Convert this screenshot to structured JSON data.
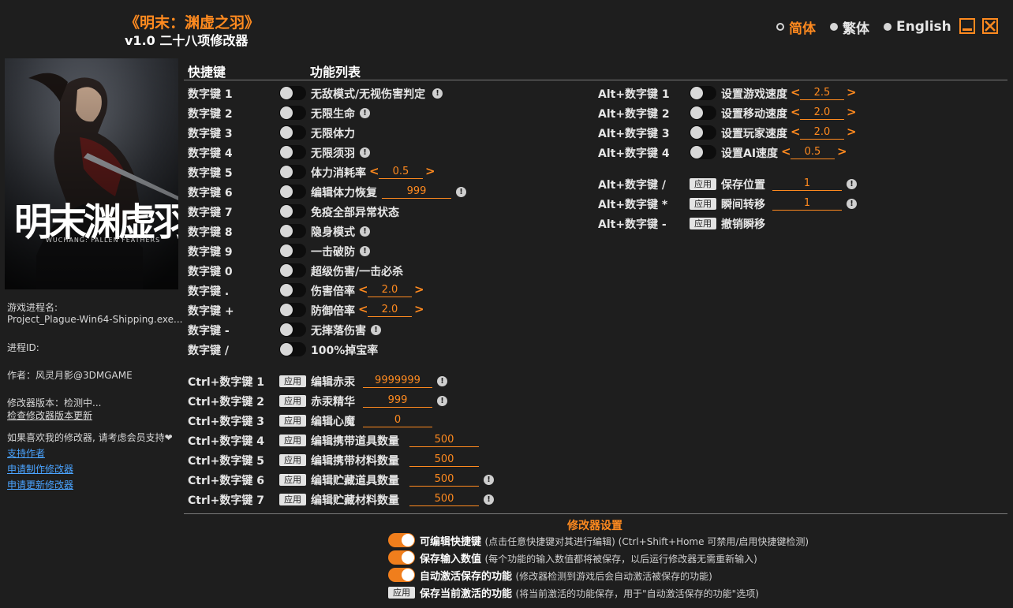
{
  "header": {
    "title": "《明末：渊虚之羽》",
    "subtitle": "v1.0 二十八项修改器",
    "languages": [
      "简体",
      "繁体",
      "English"
    ],
    "active_language": "简体"
  },
  "cover": {
    "title_art": "明末渊虚羽",
    "tagline": "WUCHANG: FALLEN FEATHERS"
  },
  "sidebar": {
    "process_label": "游戏进程名:",
    "process_name": "Project_Plague-Win64-Shipping.exe...",
    "pid_label": "进程ID:",
    "author": "作者：风灵月影@3DMGAME",
    "version": "修改器版本：检测中...",
    "check_update": "检查修改器版本更新",
    "support_text": "如果喜欢我的修改器, 请考虑会员支持❤",
    "links": [
      "支持作者",
      "申请制作修改器",
      "申请更新修改器"
    ]
  },
  "columns": {
    "hotkey": "快捷键",
    "features": "功能列表"
  },
  "apply_label": "应用",
  "left_toggles": [
    {
      "key": "数字键 1",
      "label": "无敌模式/无视伤害判定",
      "info": true
    },
    {
      "key": "数字键 2",
      "label": "无限生命",
      "info": true
    },
    {
      "key": "数字键 3",
      "label": "无限体力"
    },
    {
      "key": "数字键 4",
      "label": "无限须羽",
      "info": true
    },
    {
      "key": "数字键 5",
      "label": "体力消耗率",
      "stepper": "0.5"
    },
    {
      "key": "数字键 6",
      "label": "编辑体力恢复",
      "input": "999",
      "info": true
    },
    {
      "key": "数字键 7",
      "label": "免疫全部异常状态"
    },
    {
      "key": "数字键 8",
      "label": "隐身模式",
      "info": true
    },
    {
      "key": "数字键 9",
      "label": "一击破防",
      "info": true
    },
    {
      "key": "数字键 0",
      "label": "超级伤害/一击必杀"
    },
    {
      "key": "数字键 .",
      "label": "伤害倍率",
      "stepper": "2.0"
    },
    {
      "key": "数字键 +",
      "label": "防御倍率",
      "stepper": "2.0"
    },
    {
      "key": "数字键 -",
      "label": "无摔落伤害",
      "info": true
    },
    {
      "key": "数字键 /",
      "label": "100%掉宝率"
    }
  ],
  "ctrl_items": [
    {
      "key": "Ctrl+数字键 1",
      "label": "编辑赤汞",
      "input": "9999999",
      "info": true
    },
    {
      "key": "Ctrl+数字键 2",
      "label": "赤汞精华",
      "input": "999",
      "info": true
    },
    {
      "key": "Ctrl+数字键 3",
      "label": "编辑心魔",
      "input": "0"
    },
    {
      "key": "Ctrl+数字键 4",
      "label": "编辑携带道具数量",
      "input": "500"
    },
    {
      "key": "Ctrl+数字键 5",
      "label": "编辑携带材料数量",
      "input": "500"
    },
    {
      "key": "Ctrl+数字键 6",
      "label": "编辑贮藏道具数量",
      "input": "500",
      "info": true
    },
    {
      "key": "Ctrl+数字键 7",
      "label": "编辑贮藏材料数量",
      "input": "500",
      "info": true
    }
  ],
  "alt_toggles": [
    {
      "key": "Alt+数字键 1",
      "label": "设置游戏速度",
      "stepper": "2.5"
    },
    {
      "key": "Alt+数字键 2",
      "label": "设置移动速度",
      "stepper": "2.0"
    },
    {
      "key": "Alt+数字键 3",
      "label": "设置玩家速度",
      "stepper": "2.0"
    },
    {
      "key": "Alt+数字键 4",
      "label": "设置AI速度",
      "stepper": "0.5"
    }
  ],
  "alt_apply": [
    {
      "key": "Alt+数字键 /",
      "label": "保存位置",
      "input": "1",
      "info": true
    },
    {
      "key": "Alt+数字键 *",
      "label": "瞬间转移",
      "input": "1",
      "info": true
    },
    {
      "key": "Alt+数字键 -",
      "label": "撤销瞬移"
    }
  ],
  "settings": {
    "heading": "修改器设置",
    "items": [
      {
        "type": "toggle",
        "on": true,
        "title": "可编辑快捷键",
        "desc": "(点击任意快捷键对其进行编辑) (Ctrl+Shift+Home 可禁用/启用快捷键检测)"
      },
      {
        "type": "toggle",
        "on": true,
        "title": "保存输入数值",
        "desc": "(每个功能的输入数值都将被保存，以后运行修改器无需重新输入)"
      },
      {
        "type": "toggle",
        "on": true,
        "title": "自动激活保存的功能",
        "desc": "(修改器检测到游戏后会自动激活被保存的功能)"
      },
      {
        "type": "apply",
        "title": "保存当前激活的功能",
        "desc": "(将当前激活的功能保存，用于\"自动激活保存的功能\"选项)"
      }
    ]
  },
  "colors": {
    "accent": "#ff8a1f",
    "link": "#4aa3ff",
    "background": "#1e1e1e"
  }
}
